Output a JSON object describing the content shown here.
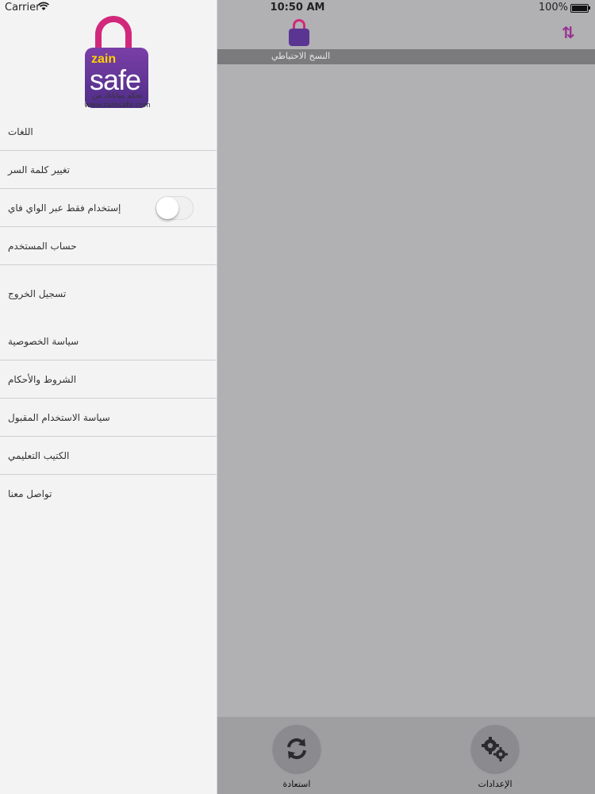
{
  "status_bar": {
    "carrier": "Carrier",
    "time": "10:50 AM",
    "battery": "100%"
  },
  "logo": {
    "brand_top": "zain",
    "brand_bottom": "safe",
    "tagline": "تحكم ببياناتك من",
    "url": "www.zainsafe.com"
  },
  "menu": {
    "items": [
      {
        "label": "اللغات"
      },
      {
        "label": "تغيير كلمة السر"
      },
      {
        "label": "إستخدام فقط عبر الواي فاي",
        "toggle": false
      },
      {
        "label": "حساب المستخدم"
      },
      {
        "label": "تسجيل الخروج"
      },
      {
        "label": "سياسة الخصوصية"
      },
      {
        "label": "الشروط والأحكام"
      },
      {
        "label": "سياسة الاستخدام المقبول"
      },
      {
        "label": "الكتيب التعليمي"
      },
      {
        "label": "تواصل معنا"
      }
    ]
  },
  "header": {
    "subtitle": "النسخ الاحتياطي"
  },
  "tabs": [
    {
      "label": "استعادة",
      "icon": "restore-icon"
    },
    {
      "label": "الإعدادات",
      "icon": "gears-icon"
    }
  ],
  "colors": {
    "accent": "#9a2f90",
    "lock_pink": "#d2287c",
    "lock_purple": "#5a3592",
    "brand_yellow": "#ffd200"
  }
}
